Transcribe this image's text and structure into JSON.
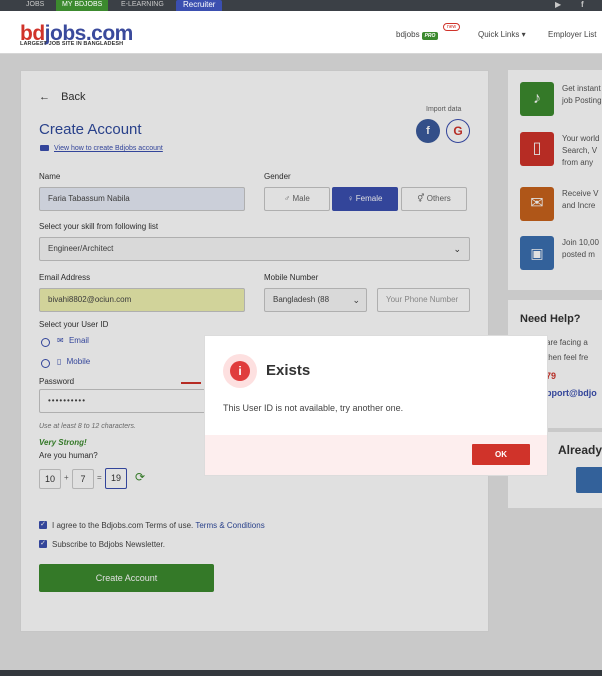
{
  "topnav": {
    "jobs": "JOBS",
    "my_bdjobs": "MY BDJOBS",
    "elearning": "E-LEARNING",
    "recruiter": "Recruiter"
  },
  "header": {
    "logo_a": "bd",
    "logo_b": "jobs.com",
    "logo_sub": "LARGEST JOB SITE IN BANGLADESH",
    "bdjobs_pro": "bdjobs",
    "pro_badge": "PRO",
    "new_badge": "new",
    "quick_links": "Quick Links ▾",
    "employer_list": "Employer List"
  },
  "form": {
    "back": "Back",
    "import_data": "Import data",
    "title": "Create Account",
    "how_to": "View how to create Bdjobs account",
    "name_label": "Name",
    "name_value": "Faria Tabassum Nabila",
    "gender_label": "Gender",
    "gender_male": "Male",
    "gender_female": "Female",
    "gender_others": "Others",
    "skill_label": "Select your skill from following list",
    "skill_value": "Engineer/Architect",
    "email_label": "Email Address",
    "email_value": "bivahi8802@ociun.com",
    "mobile_label": "Mobile Number",
    "country_value": "Bangladesh (88",
    "phone_placeholder": "Your Phone Number",
    "userid_label": "Select your User ID",
    "userid_email": "Email",
    "userid_mobile": "Mobile",
    "password_label": "Password",
    "password_value": "••••••••••",
    "password_hint": "Use at least 8 to 12 characters.",
    "strength": "Very Strong!",
    "human_label": "Are you human?",
    "captcha_a": "10",
    "captcha_plus": "+",
    "captcha_b": "7",
    "captcha_eq": "=",
    "captcha_answer": "19",
    "terms_prefix": "I agree to the Bdjobs.com Terms of use.",
    "terms_link": "Terms & Conditions",
    "newsletter": "Subscribe to Bdjobs Newsletter.",
    "submit": "Create Account"
  },
  "sidebar": {
    "features": [
      {
        "line1": "Get instant",
        "line2": "job Posting",
        "color": "#3c8a2e"
      },
      {
        "line1": "Your world",
        "line2": "Search, V",
        "line3": "from any",
        "color": "#d0332a"
      },
      {
        "line1": "Receive V",
        "line2": "and Incre",
        "color": "#c8621c"
      },
      {
        "line1": "Join 10,00",
        "line2": "posted m",
        "color": "#3b6fb0"
      }
    ],
    "help_title": "Need Help?",
    "help_line1": "are facing a",
    "help_line2": "then feel fre",
    "help_phone": "79",
    "help_email": "pport@bdjo",
    "already": "Already"
  },
  "modal": {
    "title": "Exists",
    "message": "This User ID is not available, try another one.",
    "ok": "OK"
  },
  "colors": {
    "primary": "#3b4fb0",
    "green": "#3c8a2e",
    "red": "#d0332a",
    "title_blue": "#2f4a9e"
  }
}
